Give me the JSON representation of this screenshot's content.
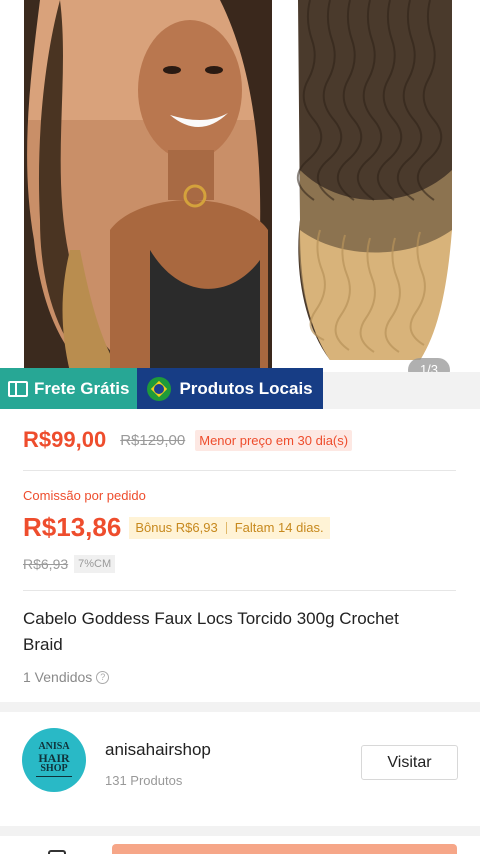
{
  "gallery": {
    "counter": "1/3"
  },
  "badges": {
    "frete": {
      "label": "Frete Grátis",
      "icon": "free-shipping-icon"
    },
    "locais": {
      "label": "Produtos Locais",
      "icon": "brazil-flag-icon"
    }
  },
  "price": {
    "current": "R$99,00",
    "original": "R$129,00",
    "tag": "Menor preço em 30 dia(s)"
  },
  "commission": {
    "label": "Comissão por pedido",
    "amount": "R$13,86",
    "bonus": "Bônus R$6,93",
    "remaining": "Faltam 14 dias.",
    "old_amount": "R$6,93",
    "rate": "7%CM"
  },
  "product": {
    "title": "Cabelo Goddess Faux Locs Torcido 300g Crochet Braid",
    "sold": "1 Vendidos"
  },
  "shop": {
    "logo_text": [
      "ANISA",
      "HAIR",
      "SHOP"
    ],
    "name": "anisahairshop",
    "products": "131 Produtos",
    "visit_label": "Visitar"
  },
  "colors": {
    "accent": "#ee4d2d",
    "frete_bg": "#27a795",
    "locais_bg": "#173d85",
    "buy_button": "#f6a688"
  }
}
